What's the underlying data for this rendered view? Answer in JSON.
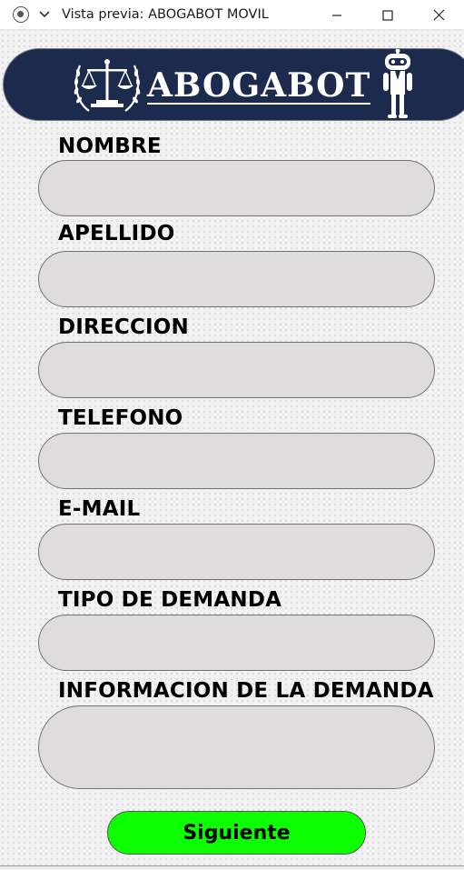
{
  "window": {
    "title": "Vista previa: ABOGABOT MOVIL",
    "icons": [
      "app-icon",
      "chevron-down-icon",
      "minimize-icon",
      "maximize-icon",
      "close-icon"
    ]
  },
  "header": {
    "logo_text": "ABOGABOT",
    "colors": {
      "banner": "#1c2a4e",
      "logo": "#ffffff"
    },
    "icons": [
      "scales-of-justice-icon",
      "robot-icon"
    ]
  },
  "form": {
    "fields": [
      {
        "label": "NOMBRE",
        "value": ""
      },
      {
        "label": "APELLIDO",
        "value": ""
      },
      {
        "label": "DIRECCION",
        "value": ""
      },
      {
        "label": "TELEFONO",
        "value": ""
      },
      {
        "label": "E-MAIL",
        "value": ""
      },
      {
        "label": "TIPO DE DEMANDA",
        "value": ""
      },
      {
        "label": "INFORMACION DE LA DEMANDA",
        "value": ""
      }
    ],
    "input_color": "#dedcdd",
    "submit_label": "Siguiente",
    "submit_color": "#0cff00"
  }
}
